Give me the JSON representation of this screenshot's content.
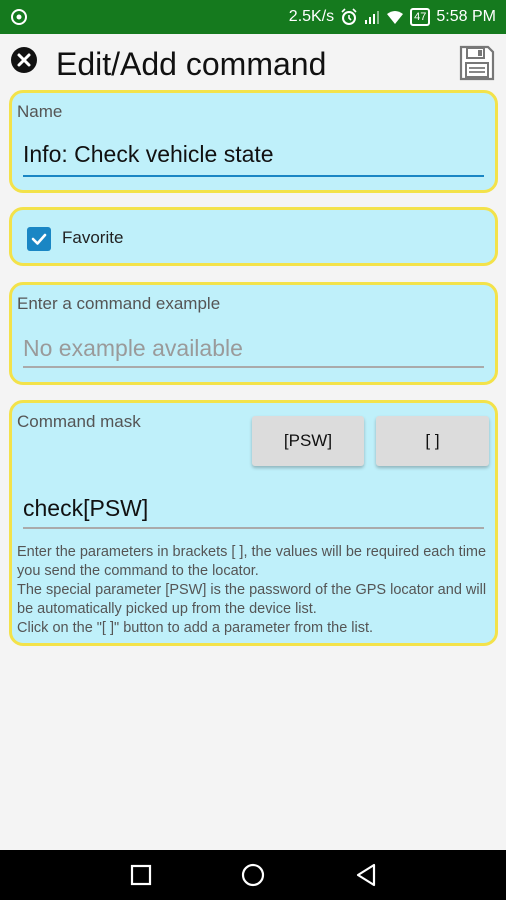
{
  "status": {
    "speed": "2.5K/s",
    "battery": "47",
    "time": "5:58 PM"
  },
  "header": {
    "title": "Edit/Add command"
  },
  "name_card": {
    "label": "Name",
    "value": "Info: Check vehicle state"
  },
  "favorite": {
    "label": "Favorite",
    "checked": true
  },
  "example_card": {
    "label": "Enter a command example",
    "placeholder": "No example available"
  },
  "mask_card": {
    "label": "Command mask",
    "psw_button": "[PSW]",
    "param_button": "[ ]",
    "value": "check[PSW]",
    "help": "Enter the parameters in brackets [ ], the values will be required each time you send the command to the locator.\nThe special parameter [PSW] is the password of the GPS locator and will be automatically picked up from the device list.\nClick on the \"[ ]\" button to add a parameter from the list."
  },
  "colors": {
    "status_bar": "#157a1e",
    "card_bg": "#bff0fa",
    "card_border": "#f3e24a",
    "active_underline": "#1a86c4",
    "checkbox": "#1a86c4"
  },
  "icons": {
    "close": "close-circle-icon",
    "save": "floppy-disk-icon",
    "nav_recents": "square-icon",
    "nav_home": "circle-icon",
    "nav_back": "triangle-back-icon"
  }
}
